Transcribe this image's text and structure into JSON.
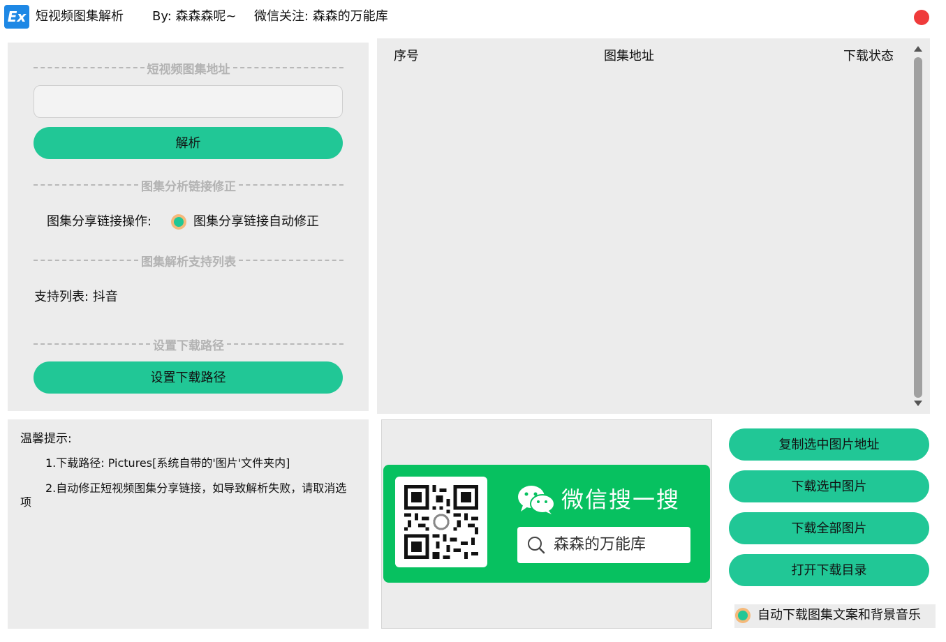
{
  "window": {
    "logo_text": "Ex",
    "title": "短视频图集解析",
    "author": "By: 森森森呢~",
    "wechat_follow": "微信关注: 森森的万能库"
  },
  "left": {
    "section_url": "短视频图集地址",
    "url_value": "",
    "parse_label": "解析",
    "section_fix": "图集分析链接修正",
    "share_op_label": "图集分享链接操作:",
    "auto_fix_label": "图集分享链接自动修正",
    "section_support": "图集解析支持列表",
    "support_list": "支持列表: 抖音",
    "section_path": "设置下载路径",
    "path_button_label": "设置下载路径"
  },
  "table": {
    "columns": [
      "序号",
      "图集地址",
      "下载状态"
    ],
    "rows": []
  },
  "tips": {
    "title": "温馨提示:",
    "line1": "1.下载路径: Pictures[系统自带的'图片'文件夹内]",
    "line2": "2.自动修正短视频图集分享链接，如导致解析失败，请取消选项"
  },
  "promo": {
    "title": "微信搜一搜",
    "search_text": "森森的万能库"
  },
  "actions": {
    "copy_selected": "复制选中图片地址",
    "download_selected": "下载选中图片",
    "download_all": "下载全部图片",
    "open_folder": "打开下载目录",
    "auto_download_label": "自动下载图集文案和背景音乐"
  },
  "colors": {
    "accent": "#21c796",
    "panel": "#ececec",
    "wechat_green": "#07c160",
    "close": "#ef3b3b",
    "logo_blue": "#1e88e5"
  }
}
